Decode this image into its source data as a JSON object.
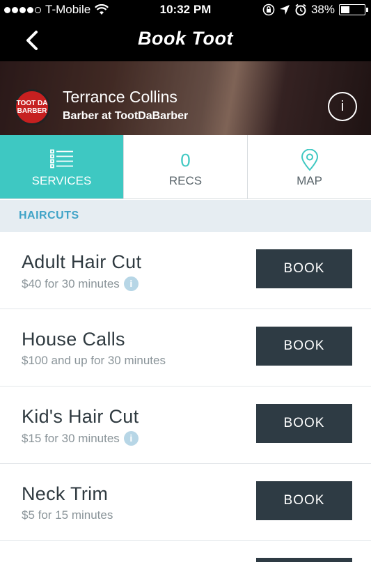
{
  "status_bar": {
    "carrier": "T-Mobile",
    "time": "10:32 PM",
    "battery": "38%",
    "battery_level": 0.38
  },
  "nav": {
    "title": "Book Toot",
    "back_icon": "chevron-left-icon"
  },
  "profile": {
    "logo_text": "TOOT DA BARBER",
    "name": "Terrance Collins",
    "subtitle": "Barber at TootDaBarber",
    "info_label": "i"
  },
  "tabs": [
    {
      "label": "SERVICES",
      "icon": "list-icon",
      "active": true
    },
    {
      "label": "RECS",
      "count": "0",
      "active": false
    },
    {
      "label": "MAP",
      "icon": "map-pin-icon",
      "active": false
    }
  ],
  "section": {
    "title": "HAIRCUTS"
  },
  "services": [
    {
      "name": "Adult Hair Cut",
      "detail": "$40 for 30 minutes",
      "has_info": true,
      "button": "BOOK"
    },
    {
      "name": "House Calls",
      "detail": "$100 and up for 30 minutes",
      "has_info": false,
      "button": "BOOK"
    },
    {
      "name": "Kid's Hair Cut",
      "detail": "$15 for 30 minutes",
      "has_info": true,
      "button": "BOOK"
    },
    {
      "name": "Neck Trim",
      "detail": "$5 for 15 minutes",
      "has_info": false,
      "button": "BOOK"
    }
  ],
  "info_dot_label": "i",
  "colors": {
    "accent": "#3ec8c2",
    "button": "#2e3b44",
    "section_text": "#3fa3c7",
    "section_bg": "#e6edf2"
  }
}
